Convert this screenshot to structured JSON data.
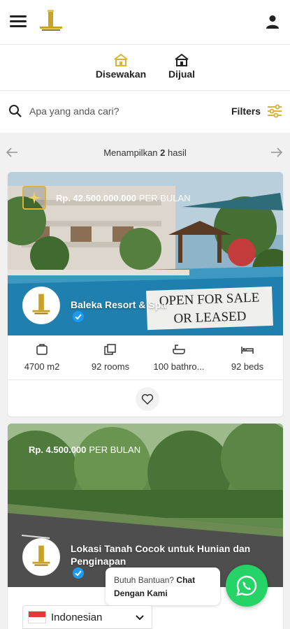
{
  "header": {
    "menu_icon": "hamburger-icon",
    "logo_icon": "gold-tower-logo",
    "profile_icon": "user-icon"
  },
  "tabs": [
    {
      "label": "Disewakan",
      "icon": "house-icon",
      "active": true,
      "icon_color": "#d8b53a"
    },
    {
      "label": "Dijual",
      "icon": "house-icon",
      "active": false
    }
  ],
  "search": {
    "placeholder": "Apa yang anda cari?",
    "filters_label": "Filters",
    "filters_icon": "sliders-icon"
  },
  "results": {
    "prefix": "Menampilkan",
    "count": "2",
    "suffix": "hasil"
  },
  "listings": [
    {
      "price": "Rp. 42.500.000.000",
      "period": "PER BULAN",
      "title": "Baleka Resort & Spa",
      "verified": true,
      "photo_sign": [
        "OPEN FOR SALE",
        "OR LEASED"
      ],
      "stats": [
        {
          "icon": "area-icon",
          "value": "4700 m2"
        },
        {
          "icon": "rooms-icon",
          "value": "92 rooms"
        },
        {
          "icon": "bath-icon",
          "value": "100 bathro..."
        },
        {
          "icon": "bed-icon",
          "value": "92 beds"
        }
      ],
      "favorite_icon": "heart-icon"
    },
    {
      "price": "Rp. 4.500.000",
      "period": "PER BULAN",
      "title_line1": "Lokasi Tanah Cocok untuk Hunian dan",
      "title_line2": "Penginapan",
      "verified": true
    }
  ],
  "chat": {
    "question": "Butuh Bantuan?",
    "action_line1": "Chat",
    "action_line2": "Dengan Kami",
    "button_icon": "whatsapp-icon"
  },
  "language": {
    "label": "Indonesian",
    "flag_icon": "indonesia-flag-icon"
  },
  "colors": {
    "accent_gold": "#d8b53a",
    "whatsapp_green": "#25d366",
    "verified_blue": "#1d9bf0"
  }
}
